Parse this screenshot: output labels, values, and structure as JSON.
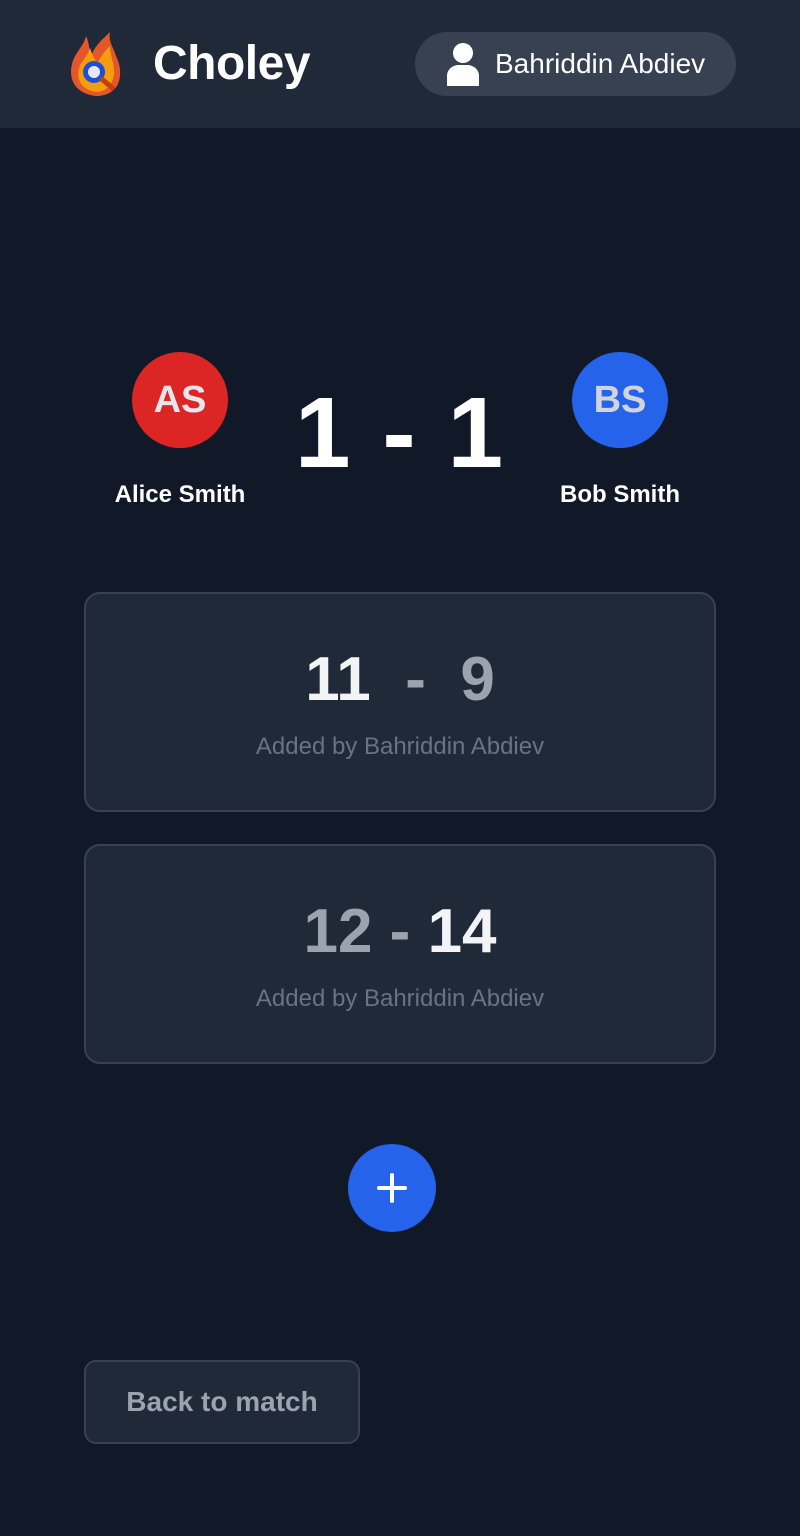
{
  "header": {
    "app_title": "Choley",
    "logo_icon": "flame-ping-pong-logo-icon",
    "user_icon": "user-icon",
    "user_name": "Bahriddin Abdiev"
  },
  "match": {
    "player_left": {
      "initials": "AS",
      "name": "Alice Smith",
      "color": "#dc2626"
    },
    "player_right": {
      "initials": "BS",
      "name": "Bob Smith",
      "color": "#2563eb"
    },
    "score_left": "1",
    "separator": "-",
    "score_right": "1"
  },
  "sets": [
    {
      "score_left": "11",
      "separator": "-",
      "score_right": "9",
      "added_by": "Added by Bahriddin Abdiev"
    },
    {
      "score_left": "12",
      "separator": "-",
      "score_right": "14",
      "added_by": "Added by Bahriddin Abdiev"
    }
  ],
  "actions": {
    "add_icon": "plus-icon",
    "back_label": "Back to match"
  },
  "colors": {
    "background": "#111827",
    "surface": "#1f2937",
    "accent": "#2563eb"
  }
}
